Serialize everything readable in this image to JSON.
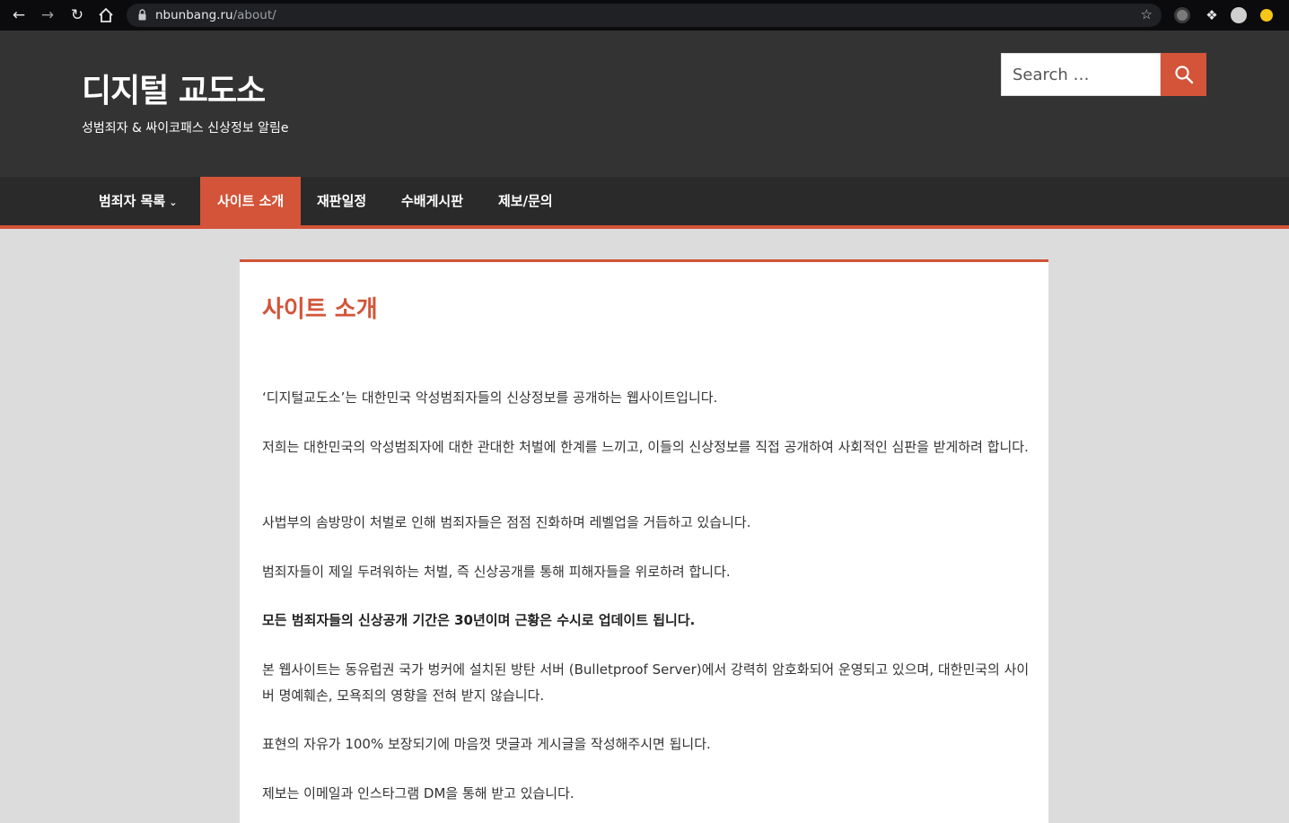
{
  "browser": {
    "url_host": "nbunbang.ru",
    "url_path": "/about/"
  },
  "header": {
    "site_title": "디지털 교도소",
    "site_description": "성범죄자 & 싸이코패스 신상정보 알림e",
    "search_placeholder": "Search …"
  },
  "nav": {
    "items": [
      {
        "label": "범죄자 목록"
      },
      {
        "label": "사이트 소개"
      },
      {
        "label": "재판일정"
      },
      {
        "label": "수배게시판"
      },
      {
        "label": "제보/문의"
      }
    ]
  },
  "main": {
    "title": "사이트 소개",
    "paragraphs": [
      "‘디지털교도소’는 대한민국 악성범죄자들의 신상정보를 공개하는 웹사이트입니다.",
      "저희는 대한민국의 악성범죄자에 대한 관대한 처벌에 한계를 느끼고, 이들의 신상정보를 직접 공개하여 사회적인 심판을 받게하려 합니다.",
      "사법부의 솜방망이 처벌로 인해 범죄자들은 점점 진화하며 레벨업을 거듭하고 있습니다.",
      "범죄자들이 제일 두려워하는 처벌, 즉 신상공개를 통해 피해자들을 위로하려 합니다.",
      "모든 범죄자들의 신상공개 기간은 30년이며 근황은 수시로 업데이트 됩니다.",
      "본 웹사이트는 동유럽권 국가 벙커에 설치된 방탄 서버 (Bulletproof Server)에서 강력히 암호화되어 운영되고 있으며, 대한민국의 사이버 명예훼손, 모욕죄의 영향을 전혀 받지 않습니다.",
      "표현의 자유가 100% 보장되기에 마음껏 댓글과 게시글을 작성해주시면 됩니다.",
      "제보는 이메일과 인스타그램 DM을 통해 받고 있습니다."
    ]
  },
  "colors": {
    "accent": "#d35438",
    "header_bg": "#333333",
    "nav_bg": "#2a2a2a",
    "page_bg": "#dcdcdc"
  },
  "icons": [
    "back-icon",
    "forward-icon",
    "reload-icon",
    "home-icon",
    "lock-icon",
    "star-icon",
    "extension-icon",
    "puzzle-icon",
    "profile-icon",
    "search-icon",
    "chevron-down-icon"
  ]
}
